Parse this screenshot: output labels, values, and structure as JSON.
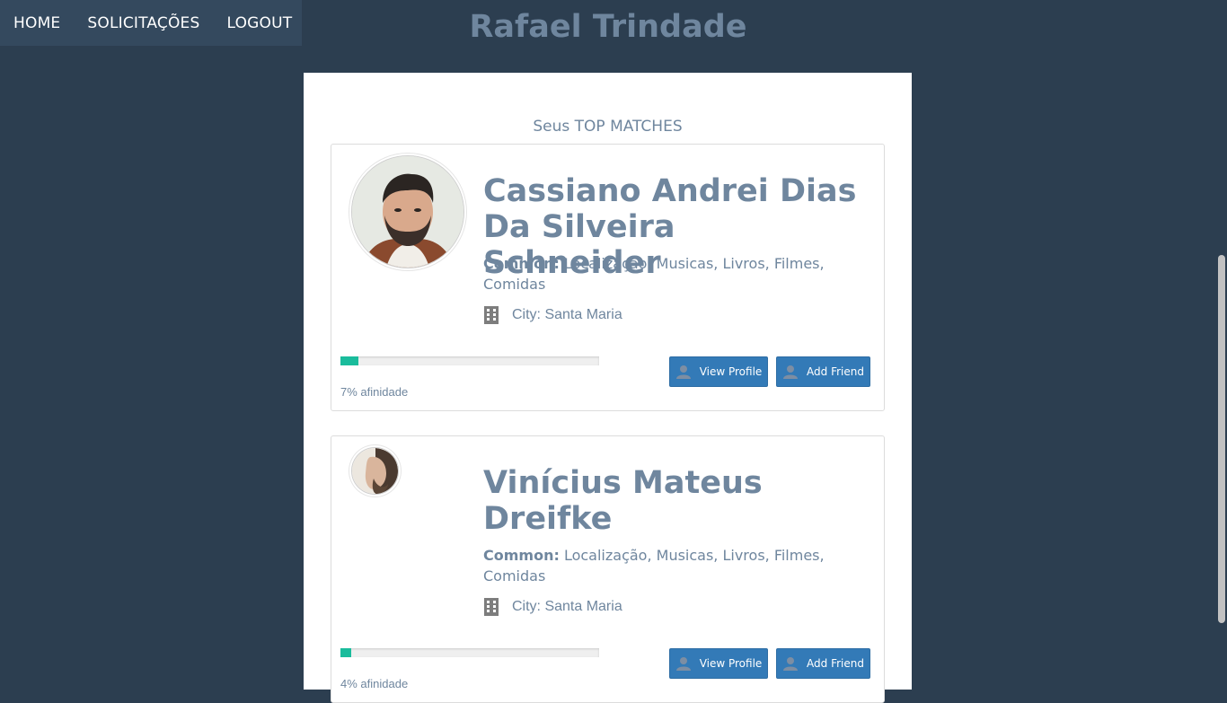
{
  "nav": {
    "items": [
      {
        "label": "HOME"
      },
      {
        "label": "SOLICITAÇÕES"
      },
      {
        "label": "LOGOUT"
      }
    ]
  },
  "header": {
    "title": "Rafael Trindade"
  },
  "main": {
    "section_title": "Seus TOP MATCHES",
    "matches": [
      {
        "name": "Cassiano Andrei Dias Da Silveira Schneider",
        "common_label": "Common:",
        "common_value": "Localização, Musicas, Livros, Filmes, Comidas",
        "city": "City: Santa Maria",
        "affinity_percent": 7,
        "affinity_text": "7% afinidade",
        "view_label": "View Profile",
        "add_label": "Add Friend"
      },
      {
        "name": "Vinícius Mateus Dreifke",
        "common_label": "Common:",
        "common_value": "Localização, Musicas, Livros, Filmes, Comidas",
        "city": "City: Santa Maria",
        "affinity_percent": 4,
        "affinity_text": "4% afinidade",
        "view_label": "View Profile",
        "add_label": "Add Friend"
      }
    ]
  },
  "colors": {
    "background": "#2c3e50",
    "nav_background": "#34495e",
    "title_text": "#6f869e",
    "button": "#337ab7",
    "progress_fill": "#1abc9c"
  },
  "icons": {
    "city": "building-icon",
    "button": "user-icon"
  }
}
